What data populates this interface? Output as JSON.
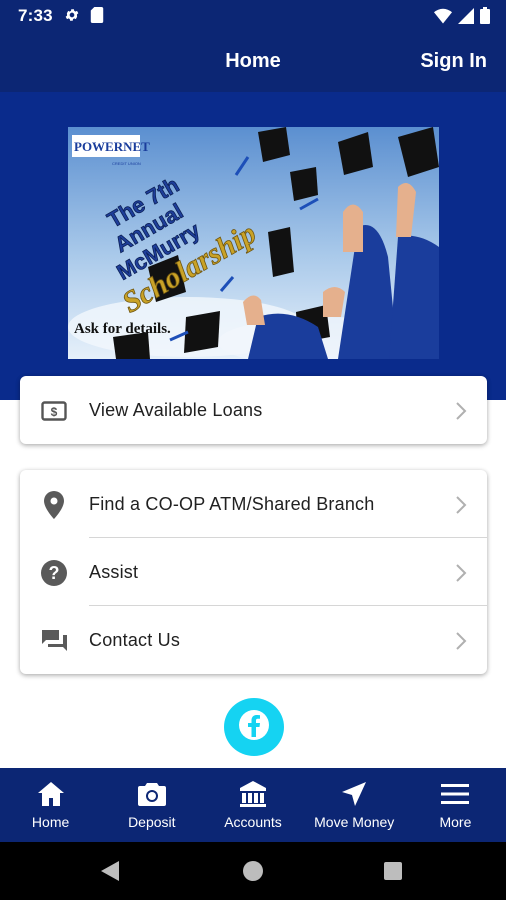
{
  "status_bar": {
    "time": "7:33"
  },
  "header": {
    "title": "Home",
    "sign_in": "Sign In"
  },
  "banner": {
    "brand": "POWERNET",
    "brand_sub": "CREDIT UNION",
    "line1": "The 7th",
    "line2": "Annual",
    "line3": "McMurry",
    "line4": "Scholarship",
    "footer": "Ask for details."
  },
  "loans_card": {
    "label": "View Available Loans"
  },
  "links_card": {
    "items": [
      {
        "label": "Find a CO-OP ATM/Shared Branch",
        "icon": "location-pin-icon"
      },
      {
        "label": "Assist",
        "icon": "help-circle-icon"
      },
      {
        "label": "Contact Us",
        "icon": "chat-icon"
      }
    ]
  },
  "social": {
    "icon": "facebook-icon"
  },
  "bottom_nav": {
    "items": [
      {
        "label": "Home",
        "icon": "home-icon"
      },
      {
        "label": "Deposit",
        "icon": "camera-icon"
      },
      {
        "label": "Accounts",
        "icon": "bank-icon"
      },
      {
        "label": "Move Money",
        "icon": "navigation-arrow-icon"
      },
      {
        "label": "More",
        "icon": "menu-icon"
      }
    ]
  },
  "colors": {
    "primary": "#0c2674",
    "hero": "#0a2b8c",
    "facebook": "#15d3f2"
  }
}
